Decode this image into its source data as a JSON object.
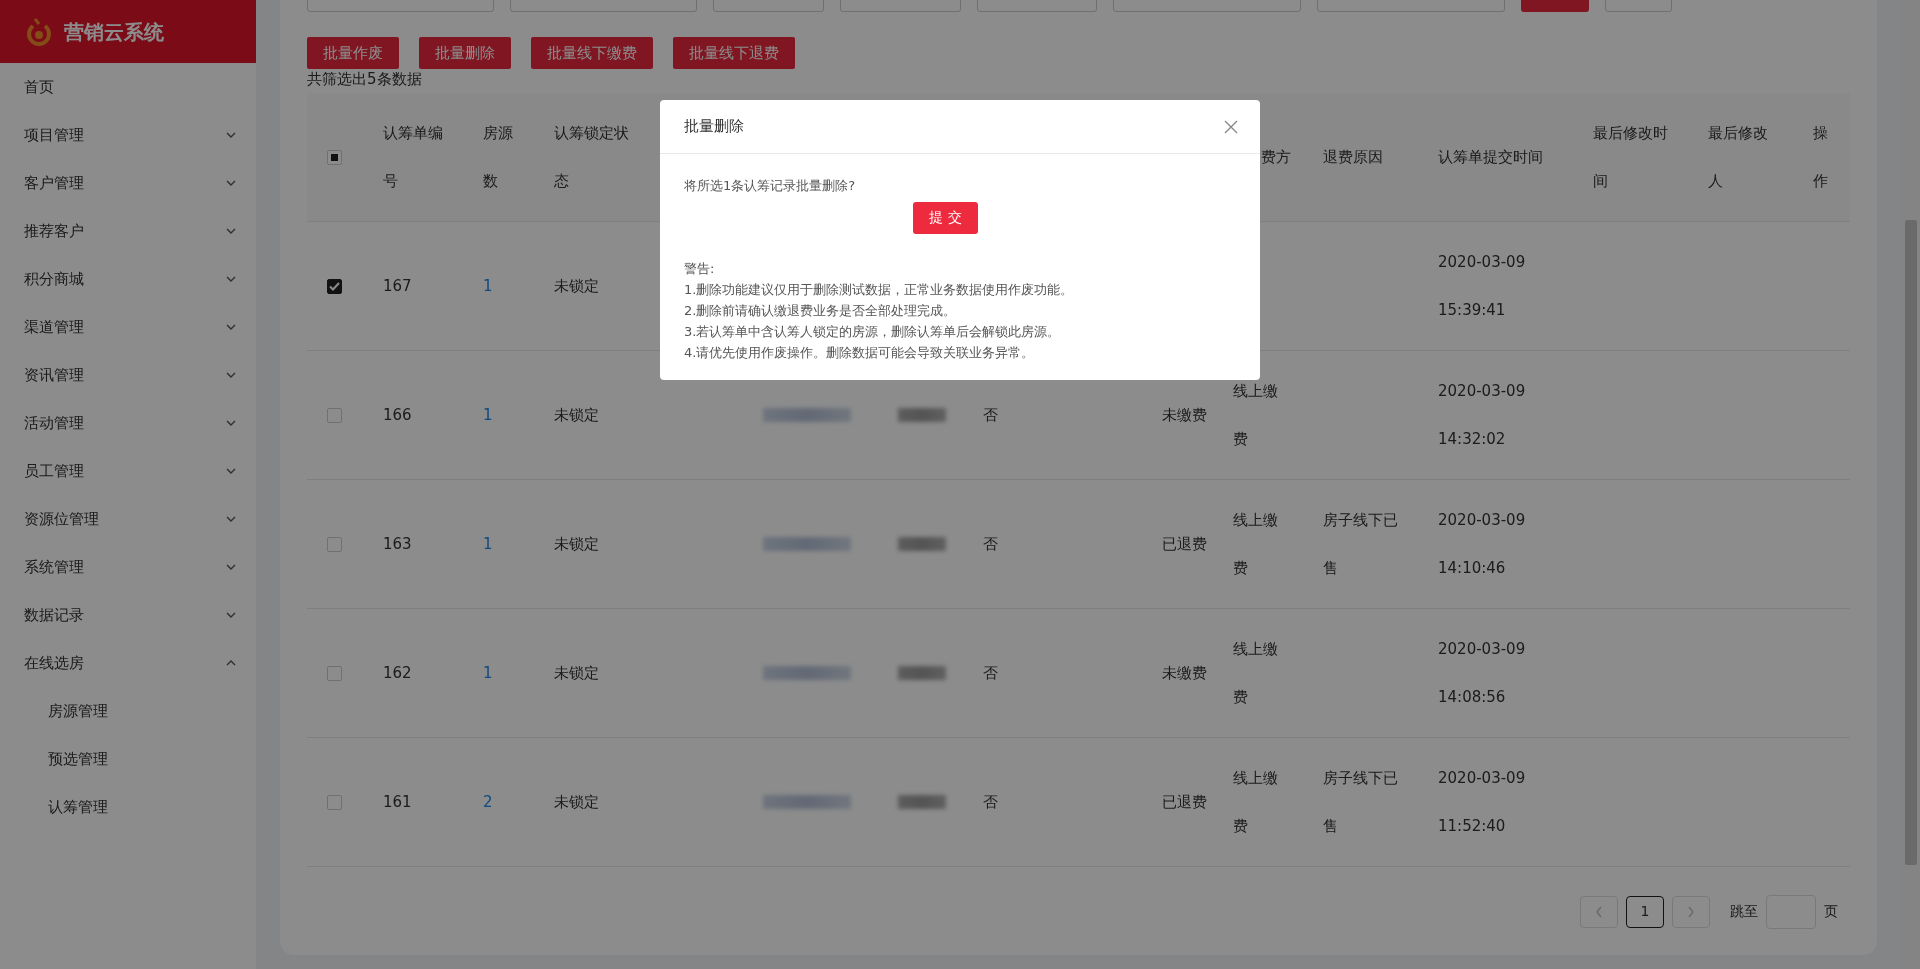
{
  "sidebar": {
    "logo_text": "营销云系统",
    "items": [
      {
        "label": "首页",
        "kind": "link"
      },
      {
        "label": "项目管理",
        "kind": "group",
        "expanded": false
      },
      {
        "label": "客户管理",
        "kind": "group",
        "expanded": false
      },
      {
        "label": "推荐客户",
        "kind": "group",
        "expanded": false
      },
      {
        "label": "积分商城",
        "kind": "group",
        "expanded": false
      },
      {
        "label": "渠道管理",
        "kind": "group",
        "expanded": false
      },
      {
        "label": "资讯管理",
        "kind": "group",
        "expanded": false
      },
      {
        "label": "活动管理",
        "kind": "group",
        "expanded": false
      },
      {
        "label": "员工管理",
        "kind": "group",
        "expanded": false
      },
      {
        "label": "资源位管理",
        "kind": "group",
        "expanded": false
      },
      {
        "label": "系统管理",
        "kind": "group",
        "expanded": false
      },
      {
        "label": "数据记录",
        "kind": "group",
        "expanded": false
      },
      {
        "label": "在线选房",
        "kind": "group",
        "expanded": true,
        "children": [
          {
            "label": "房源管理"
          },
          {
            "label": "预选管理"
          },
          {
            "label": "认筹管理"
          }
        ]
      }
    ]
  },
  "toolbar": {
    "buttons": [
      "批量作废",
      "批量删除",
      "批量线下缴费",
      "批量线下退费"
    ],
    "result_count": "共筛选出5条数据"
  },
  "table": {
    "select_all": {
      "indeterminate": true
    },
    "columns": [
      {
        "kind": "text",
        "label": "认筹单编号"
      },
      {
        "kind": "link",
        "label": "房源数"
      },
      {
        "kind": "text",
        "label": "认筹锁定状态"
      },
      {
        "kind": "redacted"
      },
      {
        "kind": "redacted"
      },
      {
        "kind": "text"
      },
      {
        "kind": "right"
      },
      {
        "kind": "text",
        "label": "费方"
      },
      {
        "kind": "text",
        "label": "退费原因"
      },
      {
        "kind": "text",
        "label": "认筹单提交时间"
      },
      {
        "kind": "text",
        "label": "最后修改时间"
      },
      {
        "kind": "text",
        "label": "最后修改人"
      },
      {
        "kind": "text",
        "label": "操作"
      }
    ],
    "rows": [
      {
        "checked": true,
        "cells": [
          "167",
          "1",
          "未锁定",
          null,
          null,
          null,
          null,
          null,
          null,
          "2020-03-09 15:39:41"
        ]
      },
      {
        "checked": false,
        "cells": [
          "166",
          "1",
          "未锁定",
          null,
          null,
          "否",
          "未缴费",
          "线上缴费",
          null,
          "2020-03-09 14:32:02"
        ]
      },
      {
        "checked": false,
        "cells": [
          "163",
          "1",
          "未锁定",
          null,
          null,
          "否",
          "已退费",
          "线上缴费",
          "房子线下已售",
          "2020-03-09 14:10:46"
        ]
      },
      {
        "checked": false,
        "cells": [
          "162",
          "1",
          "未锁定",
          null,
          null,
          "否",
          "未缴费",
          "线上缴费",
          null,
          "2020-03-09 14:08:56"
        ]
      },
      {
        "checked": false,
        "cells": [
          "161",
          "2",
          "未锁定",
          null,
          null,
          "否",
          "已退费",
          "线上缴费",
          "房子线下已售",
          "2020-03-09 11:52:40"
        ]
      }
    ]
  },
  "pagination": {
    "pages": [
      {
        "label": "1",
        "selected": true
      }
    ],
    "goto_label": "跳至",
    "page_suffix": "页"
  },
  "dialog": {
    "title": "批量删除",
    "question": "将所选1条认筹记录批量删除?",
    "submit": "提 交",
    "warning_title": "警告:",
    "warnings": [
      "1.删除功能建议仅用于删除测试数据，正常业务数据使用作废功能。",
      "2.删除前请确认缴退费业务是否全部处理完成。",
      "3.若认筹单中含认筹人锁定的房源，删除认筹单后会解锁此房源。",
      "4.请优先使用作废操作。删除数据可能会导致关联业务异常。"
    ]
  }
}
